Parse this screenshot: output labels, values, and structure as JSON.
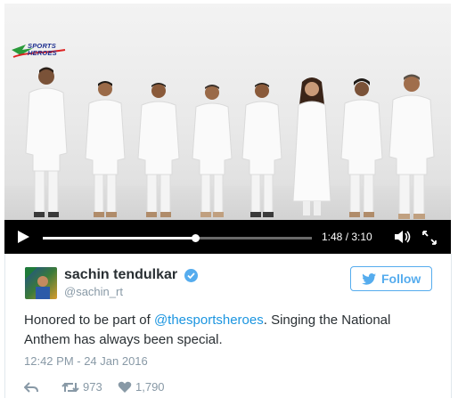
{
  "video": {
    "logo_text": "SPORTS HEROES",
    "time_display": "1:48 / 3:10",
    "progress": 0.567
  },
  "tweet": {
    "name": "sachin tendulkar",
    "handle": "@sachin_rt",
    "follow_label": "Follow",
    "text_before": "Honored to be part of ",
    "mention": "@thesportsheroes",
    "text_after": ". Singing the National Anthem has always been special.",
    "timestamp": "12:42 PM - 24 Jan 2016",
    "retweets": "973",
    "likes": "1,790"
  },
  "colors": {
    "accent": "#55acee",
    "link": "#1b95e0",
    "muted": "#8899a6"
  },
  "icons": [
    "play-icon",
    "volume-icon",
    "fullscreen-icon",
    "verified-icon",
    "twitter-bird-icon",
    "reply-icon",
    "retweet-icon",
    "heart-icon"
  ]
}
